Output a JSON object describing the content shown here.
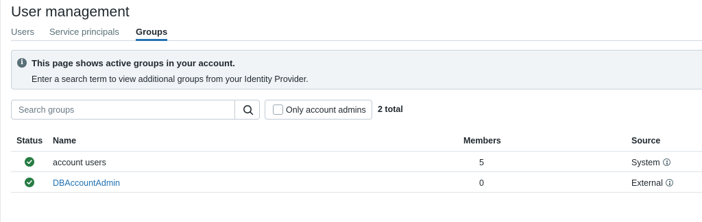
{
  "header": {
    "title": "User management"
  },
  "tabs": [
    {
      "label": "Users",
      "active": false
    },
    {
      "label": "Service principals",
      "active": false
    },
    {
      "label": "Groups",
      "active": true
    }
  ],
  "banner": {
    "icon": "info-icon",
    "title": "This page shows active groups in your account.",
    "text": "Enter a search term to view additional groups from your Identity Provider."
  },
  "toolbar": {
    "search_placeholder": "Search groups",
    "search_value": "",
    "filter_label": "Only account admins",
    "filter_checked": false,
    "total_text": "2 total"
  },
  "table": {
    "columns": [
      "Status",
      "Name",
      "Members",
      "Source"
    ],
    "rows": [
      {
        "status": "active",
        "name": "account users",
        "members": "5",
        "source": "System"
      },
      {
        "status": "active",
        "name": "DBAccountAdmin",
        "members": "0",
        "source": "External"
      }
    ]
  },
  "colors": {
    "accent": "#2272b4",
    "status_active": "#277c43",
    "banner_bg": "#f0f4f7"
  }
}
